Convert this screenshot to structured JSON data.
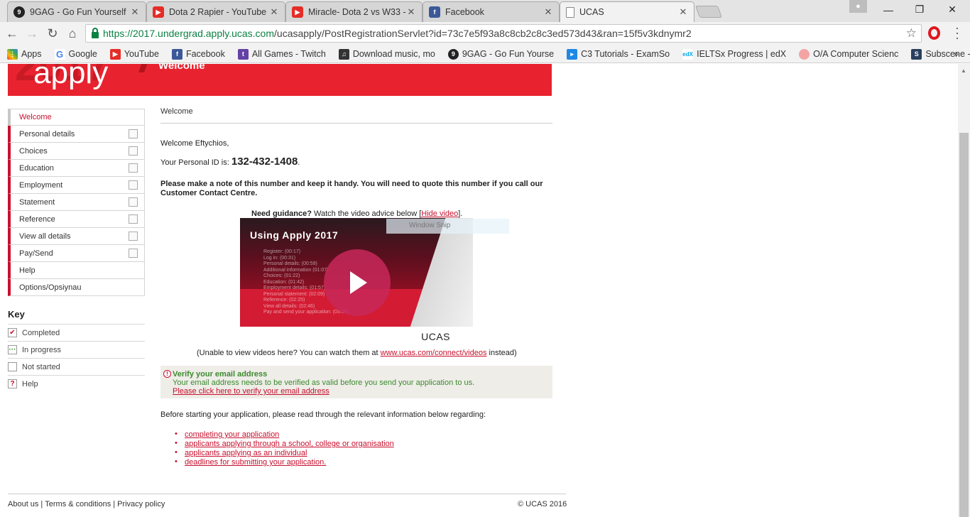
{
  "browser": {
    "tabs": [
      {
        "title": "9GAG - Go Fun Yourself",
        "icon": "9gag-icon",
        "color": "#222222"
      },
      {
        "title": "Dota 2 Rapier - YouTube",
        "icon": "youtube-icon",
        "color": "#e52d27"
      },
      {
        "title": "Miracle- Dota 2 vs W33 -",
        "icon": "youtube-icon",
        "color": "#e52d27"
      },
      {
        "title": "Facebook",
        "icon": "facebook-icon",
        "color": "#3b5998"
      },
      {
        "title": "UCAS",
        "icon": "page-icon",
        "color": "#ffffff"
      }
    ],
    "active_tab": 4,
    "url_host": "https://2017.undergrad.apply.ucas.com",
    "url_rest": "/ucasapply/PostRegistrationServlet?id=73c7e5f93a8c8cb2c8c3ed573d43&ran=15f5v3kdnymr2",
    "bookmarks": [
      {
        "label": "Apps",
        "icon": "apps-grid-icon",
        "color": "#e94235"
      },
      {
        "label": "Google",
        "icon": "google-icon",
        "color": "#4285f4"
      },
      {
        "label": "YouTube",
        "icon": "youtube-icon",
        "color": "#e52d27"
      },
      {
        "label": "Facebook",
        "icon": "facebook-icon",
        "color": "#3b5998"
      },
      {
        "label": "All Games - Twitch",
        "icon": "twitch-icon",
        "color": "#6441a5"
      },
      {
        "label": "Download music, mo",
        "icon": "music-icon",
        "color": "#333333"
      },
      {
        "label": "9GAG - Go Fun Yourse",
        "icon": "9gag-icon",
        "color": "#222222"
      },
      {
        "label": "C3 Tutorials - ExamSo",
        "icon": "c3-icon",
        "color": "#1e88e5"
      },
      {
        "label": "IELTSx Progress | edX",
        "icon": "edx-icon",
        "color": "#02a6e8"
      },
      {
        "label": "O/A Computer Scienc",
        "icon": "oa-icon",
        "color": "#f4a3a3"
      },
      {
        "label": "Subscene - Passionate",
        "icon": "subscene-icon",
        "color": "#2a3f5f"
      }
    ]
  },
  "banner": {
    "logo_text": "apply",
    "title": "Welcome"
  },
  "sidenav": [
    {
      "label": "Welcome",
      "checkbox": false
    },
    {
      "label": "Personal details",
      "checkbox": true
    },
    {
      "label": "Choices",
      "checkbox": true
    },
    {
      "label": "Education",
      "checkbox": true
    },
    {
      "label": "Employment",
      "checkbox": true
    },
    {
      "label": "Statement",
      "checkbox": true
    },
    {
      "label": "Reference",
      "checkbox": true
    },
    {
      "label": "View all details",
      "checkbox": true
    },
    {
      "label": "Pay/Send",
      "checkbox": true
    },
    {
      "label": "Help",
      "checkbox": false
    },
    {
      "label": "Options/Opsiynau",
      "checkbox": false
    }
  ],
  "key": {
    "heading": "Key",
    "items": [
      {
        "label": "Completed",
        "icon": "completed-check-icon",
        "symbol": "✔",
        "color": "#c8102e"
      },
      {
        "label": "In progress",
        "icon": "in-progress-icon",
        "symbol": "···",
        "color": "#3c8a2e"
      },
      {
        "label": "Not started",
        "icon": "not-started-icon",
        "symbol": "",
        "color": "#999999"
      },
      {
        "label": "Help",
        "icon": "help-icon",
        "symbol": "?",
        "color": "#c8102e"
      }
    ]
  },
  "main": {
    "breadcrumb": "Welcome",
    "greeting": "Welcome Eftychios,",
    "pid_label": "Your Personal ID is: ",
    "pid_value": "132-432-1408",
    "pid_suffix": ".",
    "notice": "Please make a note of this number and keep it handy. You will need to quote this number if you call our Customer Contact Centre.",
    "guidance_bold": "Need guidance?",
    "guidance_text": " Watch the video advice below [",
    "guidance_link": "Hide video",
    "guidance_end": "].",
    "video": {
      "title": "Using Apply 2017",
      "ghost_title": "Apply 2017",
      "chapters": "Register: (00:17)\nLog in: (00:31)\nPersonal details: (00:59)\nAdditional information (01:07)\nChoices: (01:22)\nEducation: (01:42)\nEmployment details: (01:57)\nPersonal statement: (02:09)\nReference: (02:25)\nView all details: (02:46)\nPay and send your application: (03:00)",
      "logo": "UCAS"
    },
    "snip_label": "Window Snip",
    "video_note_pre": "(Unable to view videos here? You can watch them at ",
    "video_note_link": "www.ucas.com/connect/videos",
    "video_note_post": " instead)",
    "verify": {
      "heading": "Verify your email address",
      "text": "Your email address needs to be verified as valid before you send your application to us.",
      "link": "Please click here to verify your email address"
    },
    "before_text": "Before starting your application, please read through the relevant information below regarding:",
    "links": [
      "completing your application",
      "applicants applying through a school, college or organisation",
      "applicants applying as an individual",
      "deadlines for submitting your application."
    ]
  },
  "footer": {
    "about": "About us",
    "terms": "Terms & conditions",
    "privacy": "Privacy policy",
    "copyright": "© UCAS 2016"
  }
}
